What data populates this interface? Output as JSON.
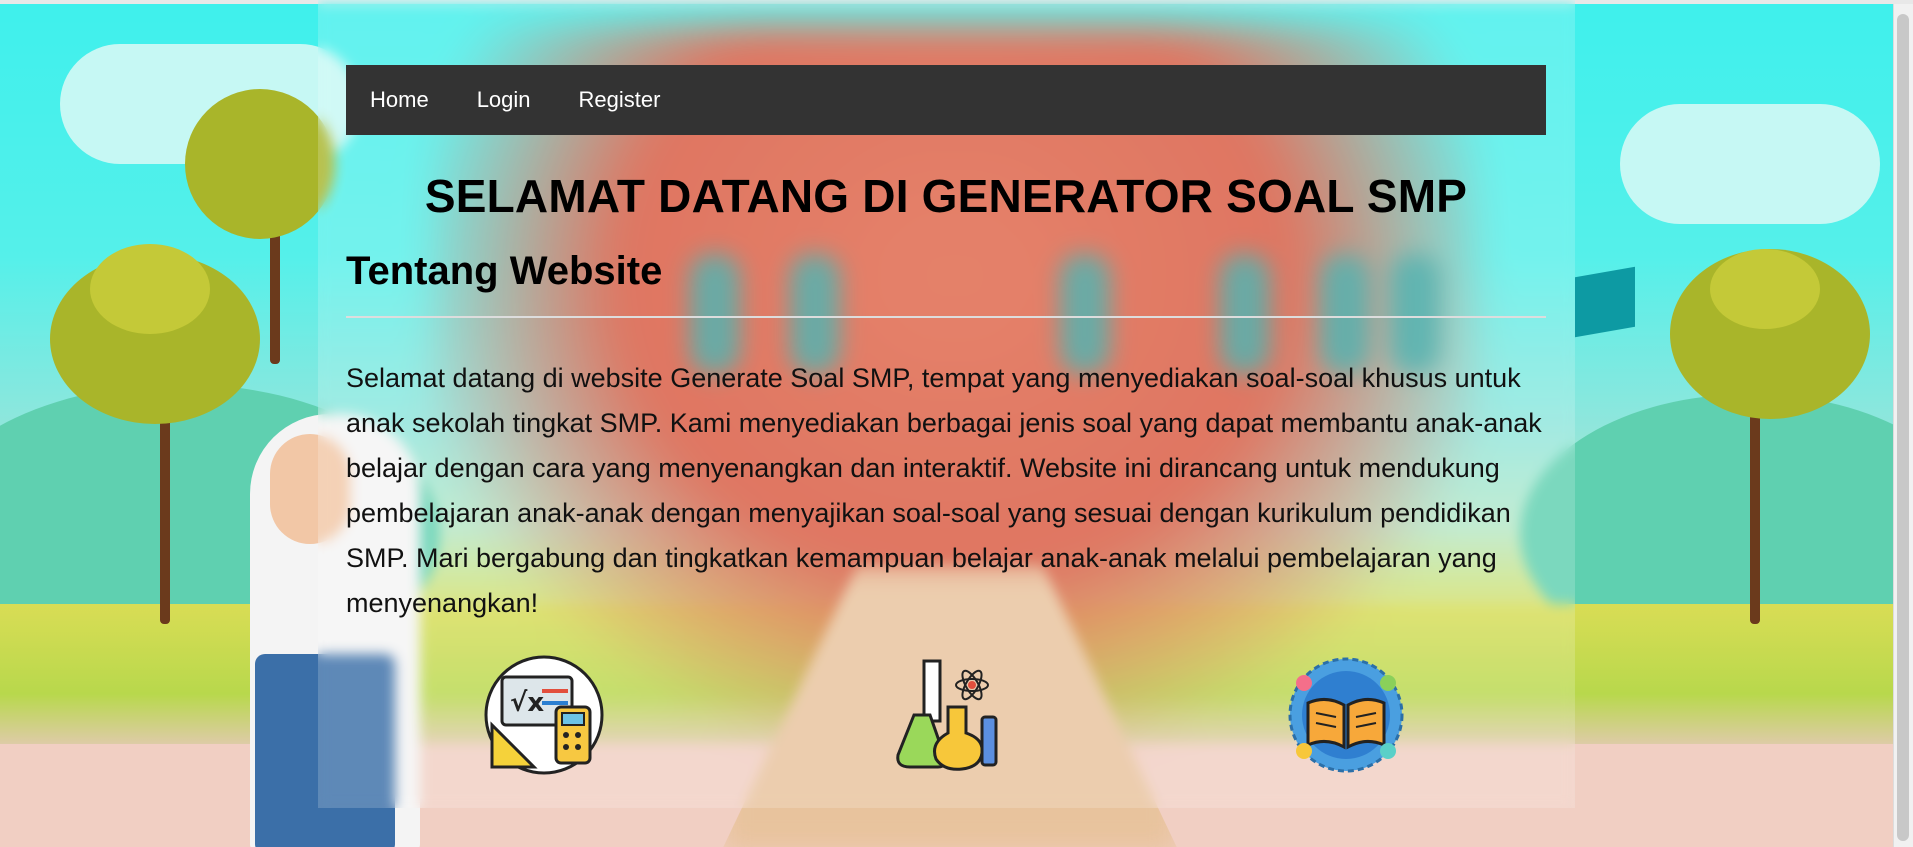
{
  "navbar": {
    "items": [
      {
        "label": "Home"
      },
      {
        "label": "Login"
      },
      {
        "label": "Register"
      }
    ]
  },
  "main": {
    "title": "SELAMAT DATANG DI GENERATOR SOAL SMP",
    "section_heading": "Tentang Website",
    "description": "Selamat datang di website Generate Soal SMP, tempat yang menyediakan soal-soal khusus untuk anak sekolah tingkat SMP. Kami menyediakan berbagai jenis soal yang dapat membantu anak-anak belajar dengan cara yang menyenangkan dan interaktif. Website ini dirancang untuk mendukung pembelajaran anak-anak dengan menyajikan soal-soal yang sesuai dengan kurikulum pendidikan SMP. Mari bergabung dan tingkatkan kemampuan belajar anak-anak melalui pembelajaran yang menyenangkan!"
  },
  "subjects": [
    {
      "icon": "math-icon"
    },
    {
      "icon": "science-icon"
    },
    {
      "icon": "world-book-icon"
    }
  ],
  "colors": {
    "navbar_bg": "#333333",
    "nav_text": "#ffffff",
    "sky": "#3ff0ec"
  }
}
